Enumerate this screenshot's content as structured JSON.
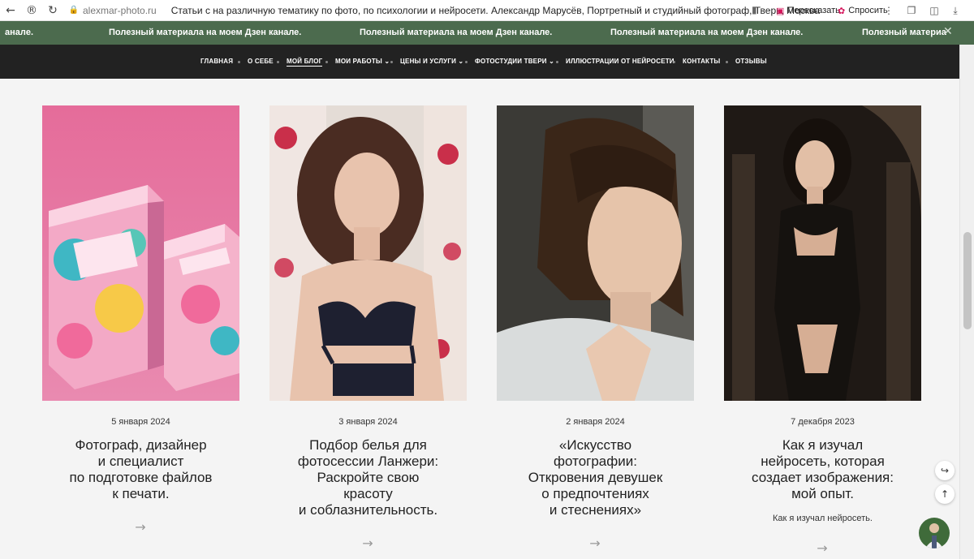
{
  "browser": {
    "domain": "alexmar-photo.ru",
    "title": "Статьи с на различную тематику по фото, по психологии и нейросети. Александр Марусёв, Портретный и студийный фотограф, Тверь, Москва",
    "retell_label": "Пересказать",
    "ask_label": "Спросить",
    "back_icon": "arrow-left-icon",
    "reload_icon": "reload-icon"
  },
  "marquee": {
    "left_fragment": "аналe.",
    "message": "Полезный материала на моем Дзен канале.",
    "right_fragment": "Полезный материа"
  },
  "nav": {
    "items": [
      {
        "label": "ГЛАВНАЯ"
      },
      {
        "label": "О СЕБЕ"
      },
      {
        "label": "МОЙ БЛОГ"
      },
      {
        "label": "МОИ РАБОТЫ ⌄"
      },
      {
        "label": "ЦЕНЫ И УСЛУГИ ⌄"
      },
      {
        "label": "ФОТОСТУДИИ ТВЕРИ ⌄"
      },
      {
        "label": "ИЛЛЮСТРАЦИИ ОТ НЕЙРОСЕТИ"
      },
      {
        "label": "КОНТАКТЫ"
      },
      {
        "label": "ОТЗЫВЫ"
      }
    ],
    "active_index": 2
  },
  "posts": [
    {
      "date": "5 января 2024",
      "title": "Фотограф, дизайнер\nи специалист\nпо подготовке файлов\nк печати.",
      "description": "",
      "arrow": "→",
      "image": "packaging-boxes-photo"
    },
    {
      "date": "3 января 2024",
      "title": "Подбор белья для\nфотосессии Ланжери:\nРаскройте свою\nкрасоту\nи соблазнительность.",
      "description": "",
      "arrow": "→",
      "image": "lingerie-portrait-photo"
    },
    {
      "date": "2 января 2024",
      "title": "«Искусство\nфотографии:\nОткровения девушек\nо предпочтениях\nи стеснениях»",
      "description": "",
      "arrow": "→",
      "image": "girl-portrait-photo"
    },
    {
      "date": "7 декабря 2023",
      "title": "Как я изучал\nнейросеть, которая\nсоздает изображения:\nмой опыт.",
      "description": "Как я изучал нейросеть.",
      "arrow": "→",
      "image": "dark-lace-portrait-photo"
    }
  ],
  "colors": {
    "marquee_bg": "#4c6b4e",
    "nav_bg": "#222222",
    "page_bg": "#f4f4f4"
  }
}
